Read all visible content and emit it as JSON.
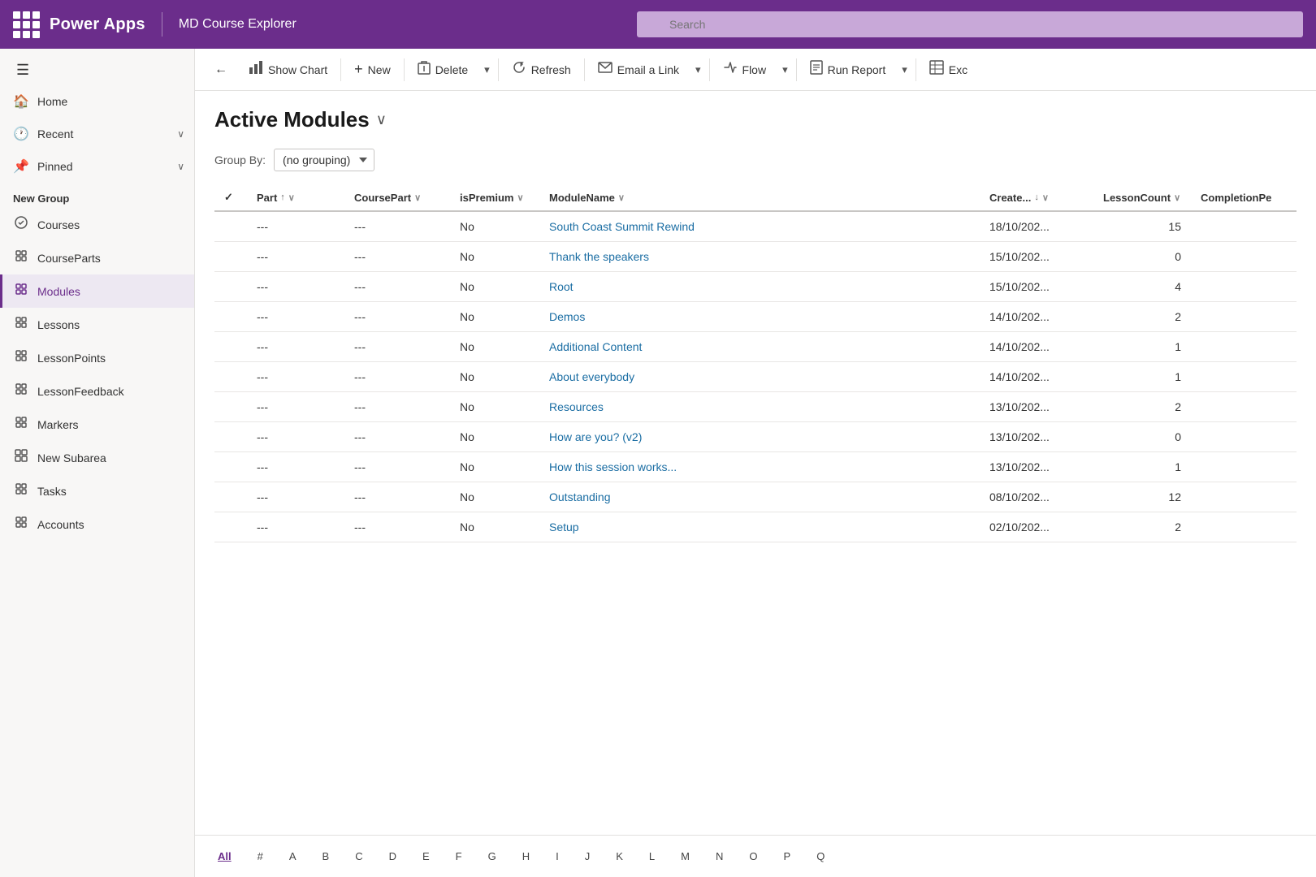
{
  "app": {
    "name": "Power Apps",
    "instance": "MD Course Explorer"
  },
  "topbar": {
    "search_placeholder": "Search"
  },
  "sidebar": {
    "hamburger": "☰",
    "nav_items": [
      {
        "id": "home",
        "label": "Home",
        "icon": "🏠",
        "has_chevron": false
      },
      {
        "id": "recent",
        "label": "Recent",
        "icon": "🕐",
        "has_chevron": true
      },
      {
        "id": "pinned",
        "label": "Pinned",
        "icon": "📌",
        "has_chevron": true
      }
    ],
    "group_label": "New Group",
    "group_items": [
      {
        "id": "courses",
        "label": "Courses",
        "icon": "📚",
        "active": false
      },
      {
        "id": "courseparts",
        "label": "CourseParts",
        "icon": "🧩",
        "active": false
      },
      {
        "id": "modules",
        "label": "Modules",
        "icon": "🧩",
        "active": true
      },
      {
        "id": "lessons",
        "label": "Lessons",
        "icon": "🧩",
        "active": false
      },
      {
        "id": "lessonpoints",
        "label": "LessonPoints",
        "icon": "🧩",
        "active": false
      },
      {
        "id": "lessonfeedback",
        "label": "LessonFeedback",
        "icon": "🧩",
        "active": false
      },
      {
        "id": "markers",
        "label": "Markers",
        "icon": "🧩",
        "active": false
      },
      {
        "id": "newsubarea",
        "label": "New Subarea",
        "icon": "⊞",
        "active": false
      },
      {
        "id": "tasks",
        "label": "Tasks",
        "icon": "🧩",
        "active": false
      },
      {
        "id": "accounts",
        "label": "Accounts",
        "icon": "🧩",
        "active": false
      }
    ]
  },
  "toolbar": {
    "back_label": "←",
    "show_chart_label": "Show Chart",
    "new_label": "New",
    "delete_label": "Delete",
    "refresh_label": "Refresh",
    "email_link_label": "Email a Link",
    "flow_label": "Flow",
    "run_report_label": "Run Report",
    "excel_label": "Exc"
  },
  "page": {
    "title": "Active Modules",
    "groupby_label": "Group By:",
    "groupby_value": "(no grouping)"
  },
  "table": {
    "columns": [
      {
        "id": "check",
        "label": "✓",
        "sortable": false
      },
      {
        "id": "part",
        "label": "Part",
        "sortable": true
      },
      {
        "id": "coursepart",
        "label": "CoursePart",
        "sortable": true
      },
      {
        "id": "ispremium",
        "label": "isPremium",
        "sortable": true
      },
      {
        "id": "modulename",
        "label": "ModuleName",
        "sortable": true
      },
      {
        "id": "created",
        "label": "Create...",
        "sortable": true,
        "sort_dir": "desc"
      },
      {
        "id": "lessoncount",
        "label": "LessonCount",
        "sortable": true
      },
      {
        "id": "completionpe",
        "label": "CompletionPe",
        "sortable": true
      }
    ],
    "rows": [
      {
        "part": "---",
        "coursepart": "---",
        "ispremium": "No",
        "modulename": "South Coast Summit Rewind",
        "created": "18/10/202...",
        "lessoncount": "15",
        "completionpe": ""
      },
      {
        "part": "---",
        "coursepart": "---",
        "ispremium": "No",
        "modulename": "Thank the speakers",
        "created": "15/10/202...",
        "lessoncount": "0",
        "completionpe": ""
      },
      {
        "part": "---",
        "coursepart": "---",
        "ispremium": "No",
        "modulename": "Root",
        "created": "15/10/202...",
        "lessoncount": "4",
        "completionpe": ""
      },
      {
        "part": "---",
        "coursepart": "---",
        "ispremium": "No",
        "modulename": "Demos",
        "created": "14/10/202...",
        "lessoncount": "2",
        "completionpe": ""
      },
      {
        "part": "---",
        "coursepart": "---",
        "ispremium": "No",
        "modulename": "Additional Content",
        "created": "14/10/202...",
        "lessoncount": "1",
        "completionpe": ""
      },
      {
        "part": "---",
        "coursepart": "---",
        "ispremium": "No",
        "modulename": "About everybody",
        "created": "14/10/202...",
        "lessoncount": "1",
        "completionpe": ""
      },
      {
        "part": "---",
        "coursepart": "---",
        "ispremium": "No",
        "modulename": "Resources",
        "created": "13/10/202...",
        "lessoncount": "2",
        "completionpe": ""
      },
      {
        "part": "---",
        "coursepart": "---",
        "ispremium": "No",
        "modulename": "How are you? (v2)",
        "created": "13/10/202...",
        "lessoncount": "0",
        "completionpe": ""
      },
      {
        "part": "---",
        "coursepart": "---",
        "ispremium": "No",
        "modulename": "How this session works...",
        "created": "13/10/202...",
        "lessoncount": "1",
        "completionpe": ""
      },
      {
        "part": "---",
        "coursepart": "---",
        "ispremium": "No",
        "modulename": "Outstanding",
        "created": "08/10/202...",
        "lessoncount": "12",
        "completionpe": ""
      },
      {
        "part": "---",
        "coursepart": "---",
        "ispremium": "No",
        "modulename": "Setup",
        "created": "02/10/202...",
        "lessoncount": "2",
        "completionpe": ""
      }
    ]
  },
  "pagination": {
    "letters": [
      "All",
      "#",
      "A",
      "B",
      "C",
      "D",
      "E",
      "F",
      "G",
      "H",
      "I",
      "J",
      "K",
      "L",
      "M",
      "N",
      "O",
      "P",
      "Q"
    ],
    "active": "All"
  }
}
